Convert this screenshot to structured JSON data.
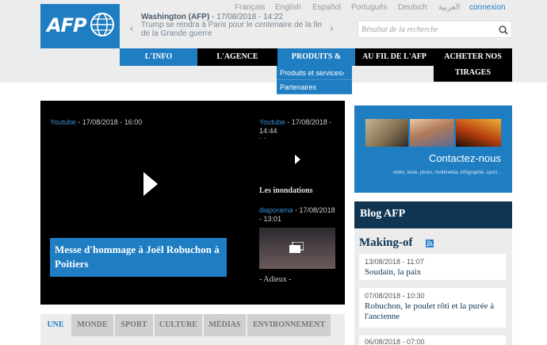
{
  "header": {
    "logo_text": "AFP",
    "languages": [
      "Français",
      "English",
      "Español",
      "Português",
      "Deutsch",
      "العربية"
    ],
    "login": "connexion",
    "ticker": {
      "prev": "‹",
      "next": "›",
      "dateline": "Washington (AFP)",
      "time": " - 17/08/2018 - 14:22",
      "headline": "Trump se rendra à Paris pour le centenaire de la fin de la Grande guerre"
    },
    "search": {
      "placeholder": "Résultat de la recherche"
    }
  },
  "nav": {
    "items": [
      {
        "label": "L'INFO"
      },
      {
        "label": "L'AGENCE"
      },
      {
        "label": "PRODUITS &"
      },
      {
        "label": "AU FIL DE L'AFP"
      },
      {
        "label": "ACHETER NOS TIRAGES"
      }
    ],
    "submenu": [
      {
        "label": "Produits et services›"
      },
      {
        "label": "Partenaires"
      }
    ]
  },
  "video": {
    "main": {
      "source": "Youtube",
      "date": " - 17/08/2018 - 16:00",
      "caption": "Messe d'hommage à Joël Robuchon à Poitiers"
    },
    "side1": {
      "source": "Youtube",
      "date": " - 17/08/2018 - 14:44",
      "dash": "- -",
      "title": "Les inondations"
    },
    "side2": {
      "source": "diaporama",
      "date": " - 17/08/2018 - 13:01",
      "title": "- Adieux -"
    }
  },
  "tabs": [
    {
      "label": "UNE"
    },
    {
      "label": "MONDE"
    },
    {
      "label": "SPORT"
    },
    {
      "label": "CULTURE"
    },
    {
      "label": "MÉDIAS"
    },
    {
      "label": "ENVIRONNEMENT"
    }
  ],
  "contact": {
    "title": "Contactez-nous",
    "subtitle": "vidéo, texte, photo, multimédia, infographie, sport..."
  },
  "blog": {
    "title": "Blog AFP",
    "section": "Making-of",
    "posts": [
      {
        "date": "13/08/2018 - 11:07",
        "title": "Soudain, la paix"
      },
      {
        "date": "07/08/2018 - 10:30",
        "title": "Robuchon, le poulet rôti et la purée à l'ancienne"
      },
      {
        "date": "06/08/2018 - 07:00",
        "title": ""
      }
    ]
  },
  "colors": {
    "afp_blue": "#1f7dc2",
    "navy": "#0f3552",
    "black": "#000000",
    "band_grey": "#ececec"
  }
}
